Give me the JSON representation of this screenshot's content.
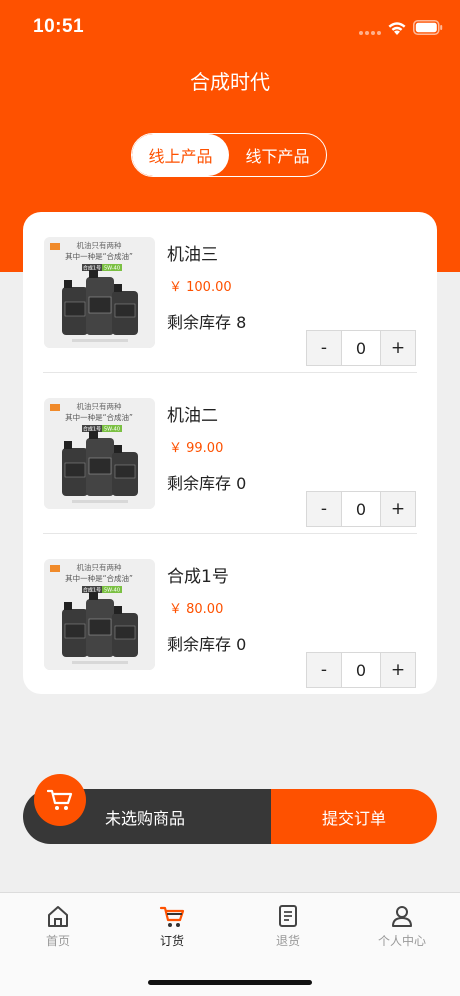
{
  "status_bar": {
    "time": "10:51"
  },
  "header": {
    "title": "合成时代"
  },
  "segment": {
    "tabs": [
      {
        "label": "线上产品",
        "active": true
      },
      {
        "label": "线下产品",
        "active": false
      }
    ]
  },
  "products": [
    {
      "name": "机油三",
      "price": "￥ 100.00",
      "stock": "剩余库存 8",
      "qty": "0",
      "minus": "-",
      "plus": "+"
    },
    {
      "name": "机油二",
      "price": "￥ 99.00",
      "stock": "剩余库存 0",
      "qty": "0",
      "minus": "-",
      "plus": "+"
    },
    {
      "name": "合成1号",
      "price": "￥ 80.00",
      "stock": "剩余库存 0",
      "qty": "0",
      "minus": "-",
      "plus": "+"
    }
  ],
  "product_image_text": {
    "line1": "机油只有两种",
    "line2": "其中一种是“合成油”",
    "badge_left": "合成1号",
    "badge_right": "5W-40"
  },
  "cart": {
    "status": "未选购商品",
    "submit_label": "提交订单"
  },
  "tab_bar": {
    "items": [
      {
        "label": "首页",
        "icon": "home-icon"
      },
      {
        "label": "订货",
        "icon": "cart-icon"
      },
      {
        "label": "退货",
        "icon": "document-icon"
      },
      {
        "label": "个人中心",
        "icon": "user-icon"
      }
    ]
  },
  "colors": {
    "accent": "#fe5100",
    "dark": "#373737",
    "background": "#efefef"
  }
}
